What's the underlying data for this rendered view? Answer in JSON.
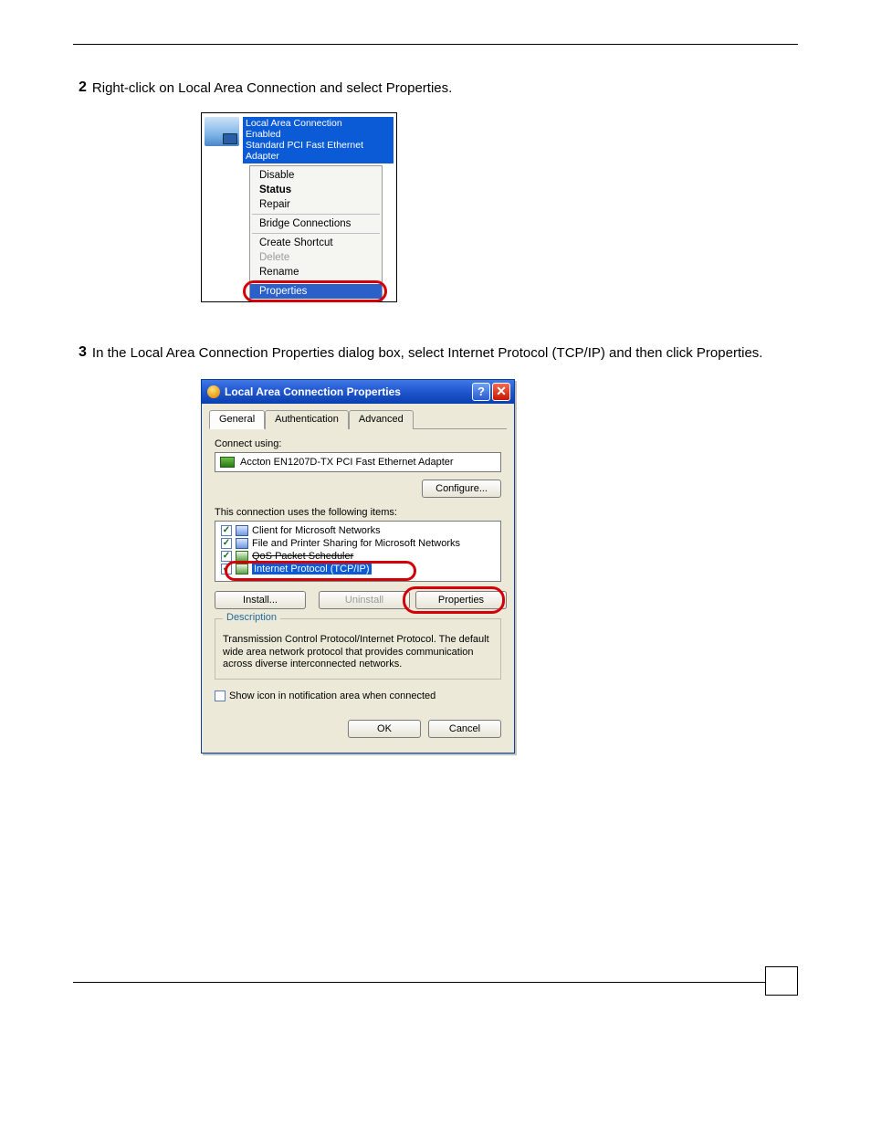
{
  "steps": {
    "s2": {
      "num": "2",
      "text": "Right-click on Local Area Connection and select Properties."
    },
    "s3": {
      "num": "3",
      "text": "In the Local Area Connection Properties dialog box, select Internet Protocol (TCP/IP) and then click Properties."
    }
  },
  "ctx": {
    "title1": "Local Area Connection",
    "title2": "Enabled",
    "title3": "Standard PCI Fast Ethernet Adapter",
    "items": {
      "disable": "Disable",
      "status": "Status",
      "repair": "Repair",
      "bridge": "Bridge Connections",
      "shortcut": "Create Shortcut",
      "delete": "Delete",
      "rename": "Rename",
      "properties": "Properties"
    }
  },
  "dlg": {
    "title": "Local Area Connection Properties",
    "tabs": {
      "general": "General",
      "auth": "Authentication",
      "adv": "Advanced"
    },
    "connect_using": "Connect using:",
    "adapter": "Accton EN1207D-TX PCI Fast Ethernet Adapter",
    "configure": "Configure...",
    "items_label": "This connection uses the following items:",
    "list": {
      "i1": "Client for Microsoft Networks",
      "i2": "File and Printer Sharing for Microsoft Networks",
      "i3": "QoS Packet Scheduler",
      "i4": "Internet Protocol (TCP/IP)"
    },
    "install": "Install...",
    "uninstall": "Uninstall",
    "properties": "Properties",
    "desc_legend": "Description",
    "desc_text": "Transmission Control Protocol/Internet Protocol. The default wide area network protocol that provides communication across diverse interconnected networks.",
    "show_icon": "Show icon in notification area when connected",
    "ok": "OK",
    "cancel": "Cancel"
  }
}
